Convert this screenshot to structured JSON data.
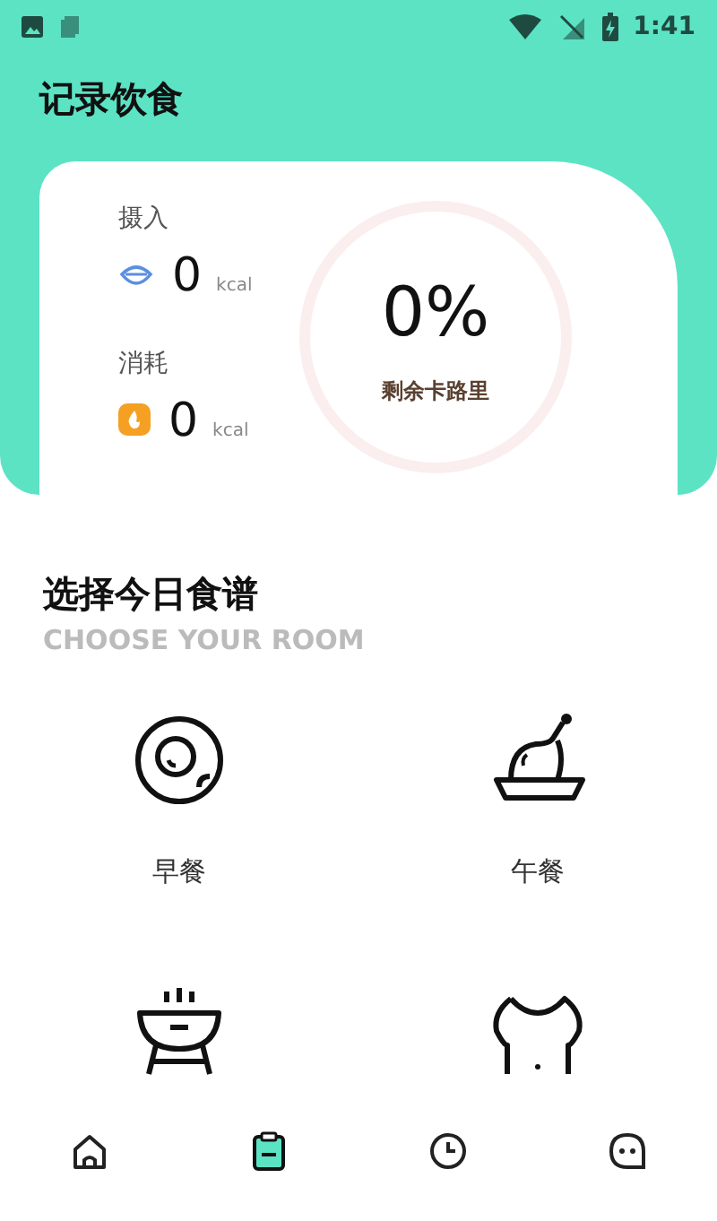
{
  "status_bar": {
    "time": "1:41"
  },
  "header": {
    "title": "记录饮食"
  },
  "summary": {
    "stats": [
      {
        "kind": "intake",
        "label": "摄入",
        "value": "0",
        "unit": "kcal"
      },
      {
        "kind": "burn",
        "label": "消耗",
        "value": "0",
        "unit": "kcal"
      }
    ],
    "ring": {
      "percent": "0%",
      "label": "剩余卡路里",
      "level": 0
    }
  },
  "section": {
    "title": "选择今日食谱",
    "subtitle": "CHOOSE YOUR ROOM"
  },
  "meals": [
    {
      "kind": "egg",
      "label": "早餐"
    },
    {
      "kind": "chicken",
      "label": "午餐"
    },
    {
      "kind": "grill"
    },
    {
      "kind": "body"
    }
  ],
  "nav": [
    {
      "kind": "home",
      "selected": false
    },
    {
      "kind": "clipboard",
      "selected": true
    },
    {
      "kind": "clock",
      "selected": false
    },
    {
      "kind": "chat",
      "selected": false
    }
  ]
}
